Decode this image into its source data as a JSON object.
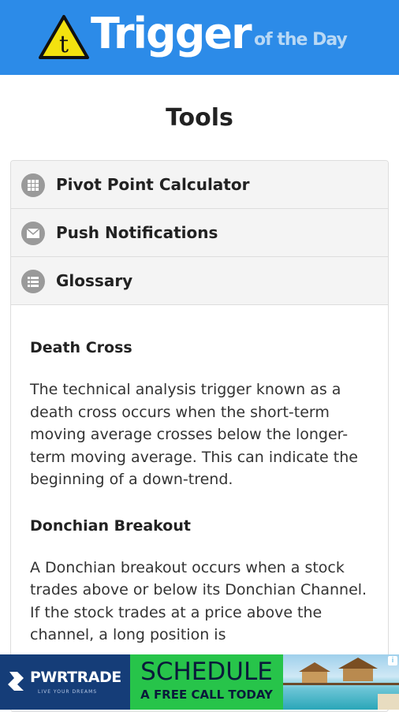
{
  "app": {
    "logo_main": "Trigger",
    "logo_sub": "of the Day",
    "logo_glyph": "t"
  },
  "page": {
    "title": "Tools"
  },
  "menu": [
    {
      "label": "Pivot Point Calculator",
      "icon": "grid-icon"
    },
    {
      "label": "Push Notifications",
      "icon": "envelope-icon"
    },
    {
      "label": "Glossary",
      "icon": "list-icon"
    }
  ],
  "glossary": [
    {
      "term": "Death Cross",
      "definition": "The technical analysis trigger known as a death cross occurs when the short-term moving average crosses below the longer-term moving average. This can indicate the beginning of a down-trend."
    },
    {
      "term": "Donchian Breakout",
      "definition": "A Donchian breakout occurs when a stock trades above or below its Donchian Channel. If the stock trades at a price above the channel, a long position is"
    }
  ],
  "ad": {
    "brand": "PWRTRADE",
    "brand_tagline": "LIVE YOUR DREAMS",
    "headline": "SCHEDULE",
    "subline": "A FREE CALL TODAY",
    "info_icon": "info-icon"
  },
  "colors": {
    "header": "#2c8be8",
    "ad_green": "#27c44a",
    "ad_navy": "#1f4e91"
  }
}
